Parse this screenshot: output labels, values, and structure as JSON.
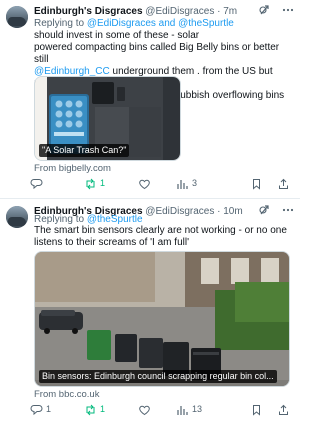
{
  "tweets": [
    {
      "name": "Edinburgh's Disgraces",
      "meta": "@EdiDisgraces · 7m",
      "reply_prefix": "Replying to ",
      "reply_to": "@EdiDisgraces and @theSpurtle",
      "text_line1": "should invest in some of these - solar",
      "text_line2": "powered compacting bins called Big Belly bins or better still",
      "mention": "@Edinburgh_CC",
      "text_line3": "underground them . from the US but used by Councils in",
      "text_line4": "Britain who care about stopping rubbish overflowing bins",
      "card_label": "\"A Solar Trash Can?\"",
      "card_source": "From bigbelly.com",
      "actions": {
        "replies": "",
        "retweets": "1",
        "likes": "",
        "views": "3"
      }
    },
    {
      "name": "Edinburgh's Disgraces",
      "meta": "@EdiDisgraces · 10m",
      "reply_prefix": "Replying to ",
      "reply_to": "@theSpurtle",
      "text_line1": "The smart bin sensors clearly are not working - or no one",
      "text_line2": "listens to their screams of 'I am full'",
      "card_label": "Bin sensors: Edinburgh council scrapping regular bin col...",
      "card_source": "From bbc.co.uk",
      "actions": {
        "replies": "1",
        "retweets": "1",
        "likes": "",
        "views": "13"
      }
    }
  ],
  "colors": {
    "link": "#1d9bf0",
    "retweet": "#00ba7c",
    "muted": "#536471"
  },
  "icons": [
    "avatar",
    "grok-icon",
    "more-icon",
    "reply-icon",
    "retweet-icon",
    "like-icon",
    "views-icon",
    "bookmark-icon",
    "share-icon"
  ]
}
